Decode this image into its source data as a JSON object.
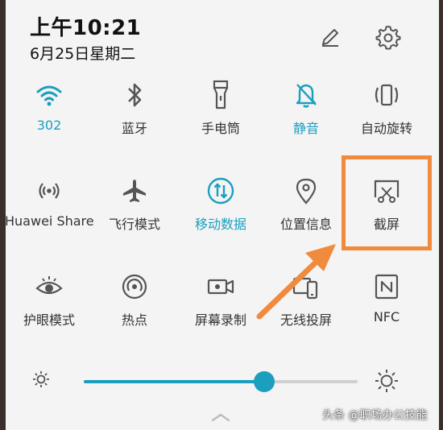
{
  "status": {
    "time": "上午10:21",
    "date": "6月25日星期二"
  },
  "tiles": [
    {
      "label": "302",
      "icon": "wifi-icon",
      "active": true
    },
    {
      "label": "蓝牙",
      "icon": "bluetooth-icon",
      "active": false
    },
    {
      "label": "手电筒",
      "icon": "flashlight-icon",
      "active": false
    },
    {
      "label": "静音",
      "icon": "bell-off-icon",
      "active": true
    },
    {
      "label": "自动旋转",
      "icon": "auto-rotate-icon",
      "active": false
    },
    {
      "label": "Huawei Share",
      "icon": "huawei-share-icon",
      "active": false
    },
    {
      "label": "飞行模式",
      "icon": "airplane-icon",
      "active": false
    },
    {
      "label": "移动数据",
      "icon": "mobile-data-icon",
      "active": true
    },
    {
      "label": "位置信息",
      "icon": "location-icon",
      "active": false
    },
    {
      "label": "截屏",
      "icon": "screenshot-icon",
      "active": false
    },
    {
      "label": "护眼模式",
      "icon": "eye-icon",
      "active": false
    },
    {
      "label": "热点",
      "icon": "hotspot-icon",
      "active": false
    },
    {
      "label": "屏幕录制",
      "icon": "screen-record-icon",
      "active": false
    },
    {
      "label": "无线投屏",
      "icon": "wireless-projection-icon",
      "active": false
    },
    {
      "label": "NFC",
      "icon": "nfc-icon",
      "active": false
    }
  ],
  "brightness": {
    "level": 0.66
  },
  "watermark": "头条 @职场办公技能",
  "colors": {
    "accent": "#1a9fbf",
    "highlight": "#f08a3c",
    "text": "#333333"
  }
}
